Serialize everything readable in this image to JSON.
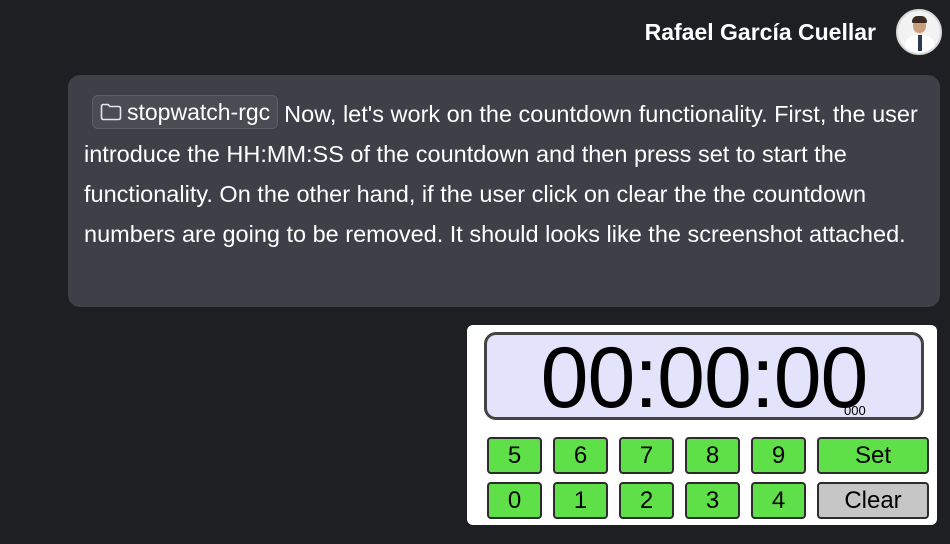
{
  "user": {
    "name": "Rafael García Cuellar"
  },
  "message": {
    "folder": "stopwatch-rgc",
    "text": "Now, let's work on the countdown functionality. First, the user introduce the HH:MM:SS of the countdown and then press set to start the functionality. On the other hand, if the user click on clear the the countdown numbers are going to be removed. It should looks like the screenshot attached."
  },
  "attachment": {
    "time": "00:00:00",
    "ms": "000",
    "keys_row1": [
      "5",
      "6",
      "7",
      "8",
      "9"
    ],
    "keys_row2": [
      "0",
      "1",
      "2",
      "3",
      "4"
    ],
    "set_label": "Set",
    "clear_label": "Clear",
    "colors": {
      "green_key": "#5fe048",
      "gray_key": "#c6c6c6",
      "display_bg": "#e3e3fb"
    }
  },
  "icons": {
    "folder": "folder-icon",
    "avatar": "user-avatar"
  }
}
